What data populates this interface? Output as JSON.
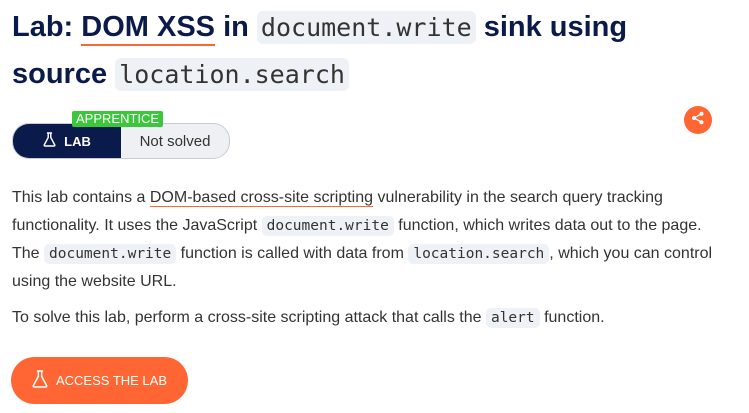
{
  "title": {
    "prefix": "Lab: ",
    "topic": "DOM XSS",
    "in": " in ",
    "sink_code": "document.write",
    "middle": " sink using source ",
    "source_code": "location.search"
  },
  "badge": {
    "level": "APPRENTICE",
    "lab_label": "LAB",
    "status": "Not solved"
  },
  "description": {
    "t1": "This lab contains a ",
    "link": "DOM-based cross-site scripting",
    "t2": " vulnerability in the search query tracking functionality. It uses the JavaScript ",
    "c1": "document.write",
    "t3": " function, which writes data out to the page. The ",
    "c2": "document.write",
    "t4": " function is called with data from ",
    "c3": "location.search",
    "t5": ", which you can control using the website URL."
  },
  "instruction": {
    "t1": "To solve this lab, perform a cross-site scripting attack that calls the ",
    "c1": "alert",
    "t2": " function."
  },
  "access_button": {
    "label": "ACCESS THE LAB"
  },
  "colors": {
    "navy": "#0a1b4b",
    "orange": "#ff6633",
    "green": "#3cc63c"
  },
  "icons": [
    "flask-icon",
    "share-icon"
  ]
}
